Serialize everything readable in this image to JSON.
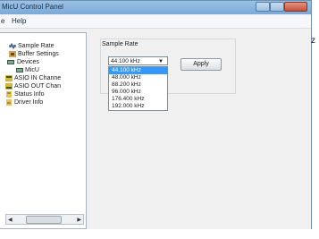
{
  "window": {
    "title": "MicU Control Panel"
  },
  "menu": {
    "items": [
      "e",
      "Help"
    ]
  },
  "tree": {
    "items": [
      {
        "label": "Sample Rate",
        "icon": "sample-rate-icon"
      },
      {
        "label": "Buffer Settings",
        "icon": "buffer-icon"
      },
      {
        "label": "Devices",
        "icon": "devices-icon"
      },
      {
        "label": "MicU",
        "icon": "device-icon"
      },
      {
        "label": "ASIO IN Channe",
        "icon": "asio-in-icon"
      },
      {
        "label": "ASIO OUT Chan",
        "icon": "asio-out-icon"
      },
      {
        "label": "Status Info",
        "icon": "status-icon"
      },
      {
        "label": "Driver Info",
        "icon": "driver-icon"
      }
    ]
  },
  "panel": {
    "group_label": "Sample Rate",
    "selected": "44.100 kHz",
    "apply_label": "Apply",
    "options": [
      "44.100 kHz",
      "48.000 kHz",
      "88.200 kHz",
      "96.000 kHz",
      "176.400 kHz",
      "192.000 kHz"
    ]
  },
  "edge_text": "z"
}
